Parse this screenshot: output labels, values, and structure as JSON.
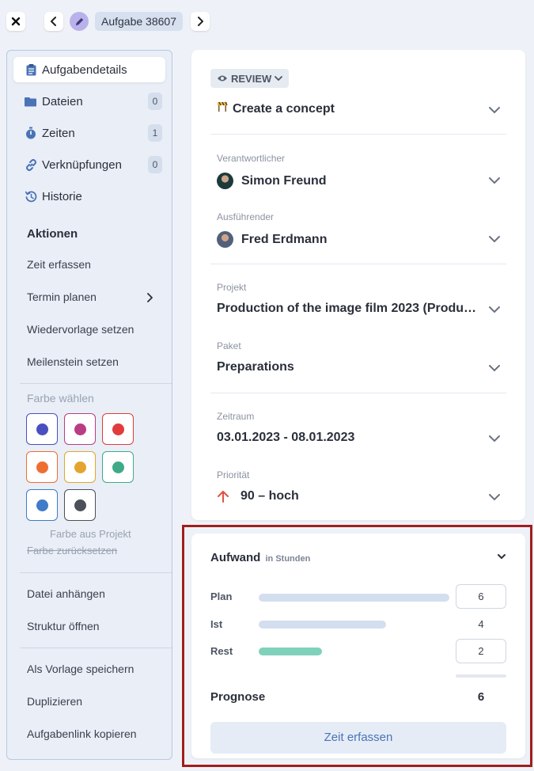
{
  "topbar": {
    "title": "Aufgabe 38607"
  },
  "sidebar": {
    "nav": [
      {
        "label": "Aufgabendetails",
        "icon": "clipboard-icon",
        "badge": null
      },
      {
        "label": "Dateien",
        "icon": "folder-icon",
        "badge": "0"
      },
      {
        "label": "Zeiten",
        "icon": "stopwatch-icon",
        "badge": "1"
      },
      {
        "label": "Verknüpfungen",
        "icon": "link-icon",
        "badge": "0"
      },
      {
        "label": "Historie",
        "icon": "history-icon",
        "badge": null
      }
    ],
    "actions_title": "Aktionen",
    "actions": [
      "Zeit erfassen",
      "Termin planen",
      "Wiedervorlage setzen",
      "Meilenstein setzen"
    ],
    "color_title": "Farbe wählen",
    "colors": [
      "#4a4fc0",
      "#b93d84",
      "#e23b3b",
      "#ee6e32",
      "#e3a52f",
      "#3faa8a",
      "#3f7bc8",
      "#4c5058"
    ],
    "color_from_project": "Farbe aus Projekt",
    "color_reset": "Farbe zurücksetzen",
    "file_actions": [
      "Datei anhängen",
      "Struktur öffnen"
    ],
    "misc_actions": [
      "Als Vorlage speichern",
      "Duplizieren",
      "Aufgabenlink kopieren"
    ]
  },
  "details": {
    "status": "REVIEW",
    "task_name": "Create a concept",
    "responsible_label": "Verantwortlicher",
    "responsible": "Simon Freund",
    "executor_label": "Ausführender",
    "executor": "Fred Erdmann",
    "project_label": "Projekt",
    "project": "Production of the image film 2023 (Produk...",
    "package_label": "Paket",
    "package": "Preparations",
    "period_label": "Zeitraum",
    "period": "03.01.2023 - 08.01.2023",
    "priority_label": "Priorität",
    "priority": "90 – hoch"
  },
  "effort": {
    "title": "Aufwand",
    "unit": "in Stunden",
    "plan_label": "Plan",
    "plan": "6",
    "actual_label": "Ist",
    "actual": "4",
    "rest_label": "Rest",
    "rest": "2",
    "forecast_label": "Prognose",
    "forecast": "6",
    "bar_fraction": {
      "plan": 1.0,
      "actual": 0.667,
      "rest": 0.333
    },
    "button": "Zeit erfassen"
  },
  "colors": {
    "accent": "#4a73b6",
    "highlight": "#a11d1d",
    "rest_bar": "#7fd1bb",
    "plan_bar": "#d3deef"
  }
}
